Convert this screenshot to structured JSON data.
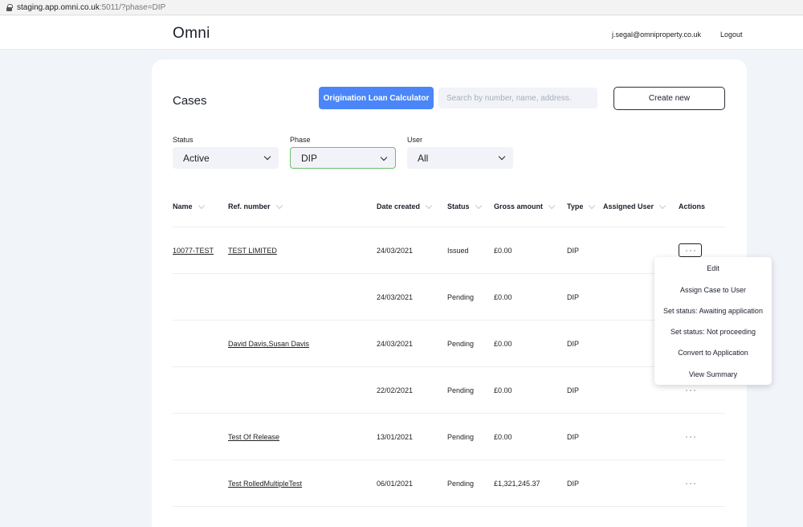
{
  "browser": {
    "url_host": "staging.app.omni.co.uk",
    "url_rest": ":5011/?phase=DIP"
  },
  "nav": {
    "brand": "Omni",
    "user_email": "j.segal@omniproperty.co.uk",
    "logout": "Logout"
  },
  "header": {
    "title": "Cases",
    "calculator_button": "Origination Loan Calculator",
    "search_placeholder": "Search by number, name, address.",
    "create_button": "Create new"
  },
  "filters": {
    "status": {
      "label": "Status",
      "value": "Active"
    },
    "phase": {
      "label": "Phase",
      "value": "DIP"
    },
    "user": {
      "label": "User",
      "value": "All"
    }
  },
  "table": {
    "columns": [
      "Name",
      "Ref. number",
      "Date created",
      "Status",
      "Gross amount",
      "Type",
      "Assigned User",
      "Actions"
    ],
    "rows": [
      {
        "name": "10077-TEST",
        "ref": "TEST LIMITED",
        "date": "24/03/2021",
        "status": "Issued",
        "amount": "£0.00",
        "type": "DIP"
      },
      {
        "name": "",
        "ref": "",
        "date": "24/03/2021",
        "status": "Pending",
        "amount": "£0.00",
        "type": "DIP"
      },
      {
        "name": "",
        "ref": "David Davis,Susan Davis",
        "date": "24/03/2021",
        "status": "Pending",
        "amount": "£0.00",
        "type": "DIP"
      },
      {
        "name": "",
        "ref": "",
        "date": "22/02/2021",
        "status": "Pending",
        "amount": "£0.00",
        "type": "DIP"
      },
      {
        "name": "",
        "ref": "Test Of Release",
        "date": "13/01/2021",
        "status": "Pending",
        "amount": "£0.00",
        "type": "DIP"
      },
      {
        "name": "",
        "ref": "Test RolledMultipleTest",
        "date": "06/01/2021",
        "status": "Pending",
        "amount": "£1,321,245.37",
        "type": "DIP"
      }
    ]
  },
  "actions_menu": {
    "items": [
      "Edit",
      "Assign Case to User",
      "Set status: Awaiting application",
      "Set status: Not proceeding",
      "Convert to Application",
      "View Summary"
    ]
  },
  "colors": {
    "primary": "#4a86f7",
    "phase_border": "#69c06d",
    "background": "#f1f4f9"
  }
}
